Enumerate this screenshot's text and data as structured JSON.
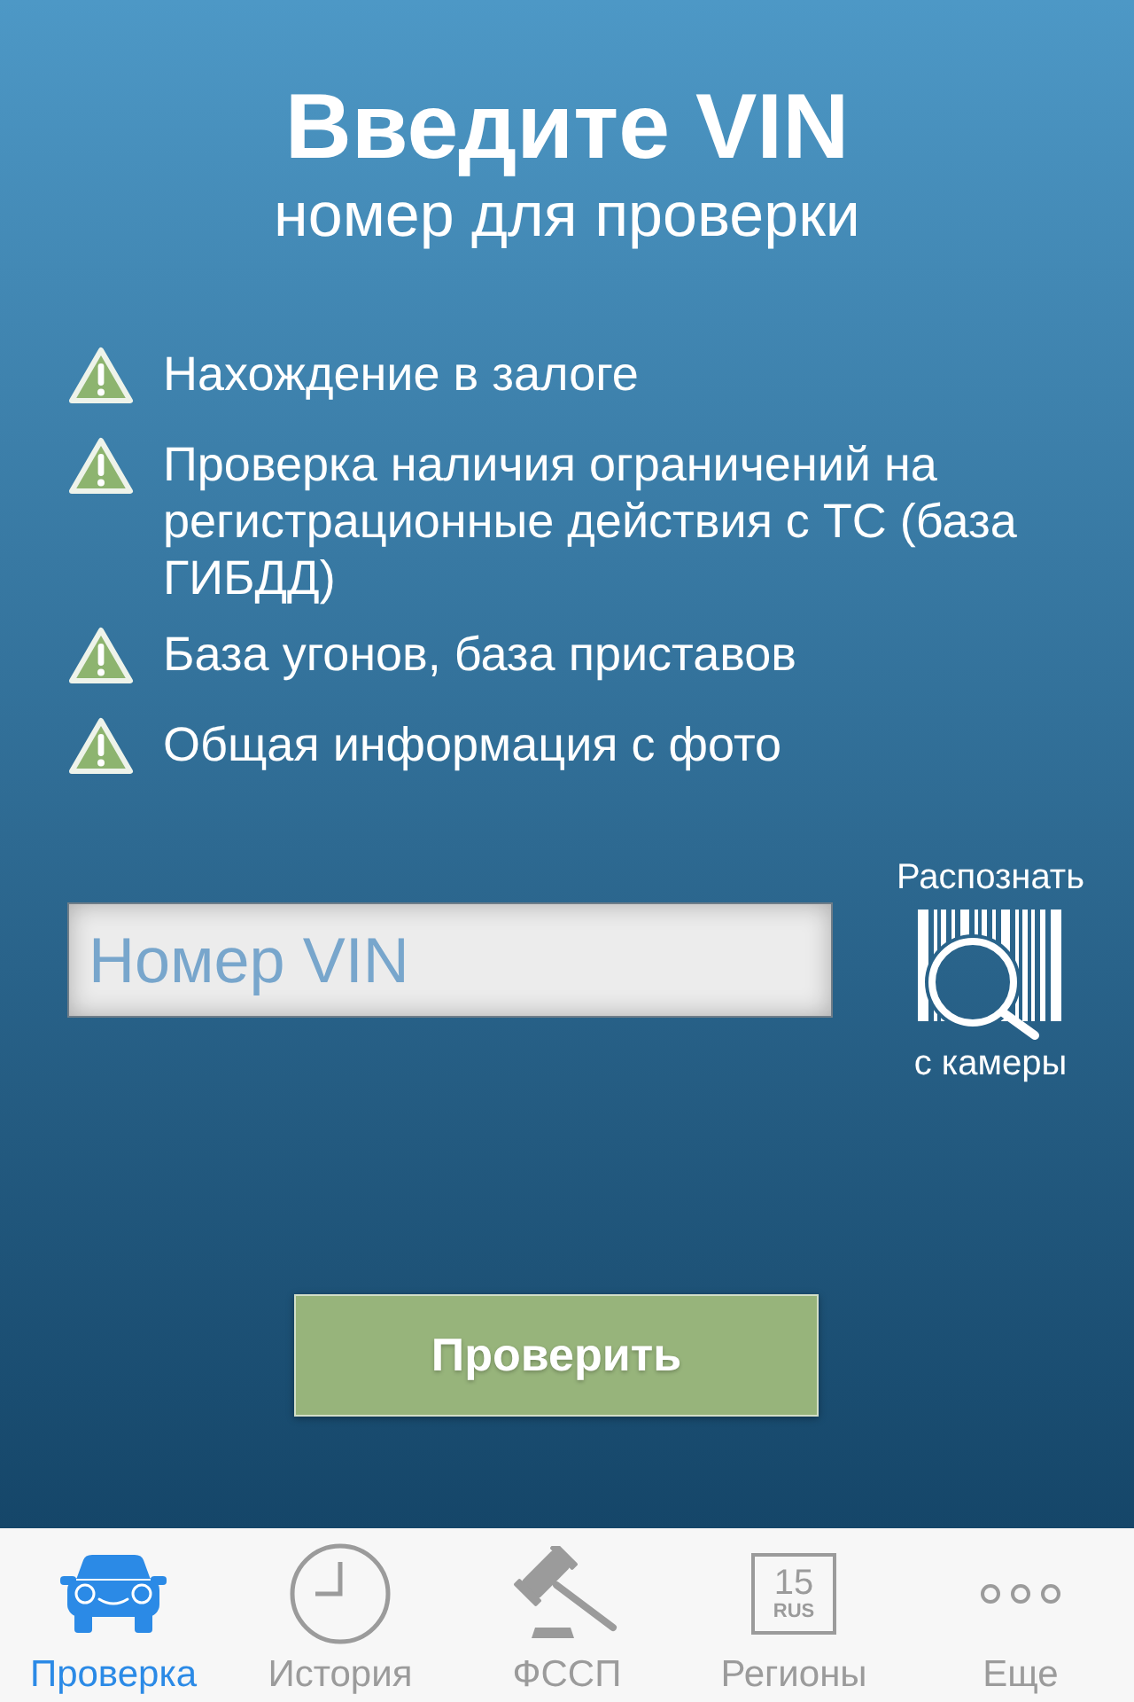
{
  "header": {
    "title": "Введите VIN",
    "subtitle": "номер для проверки"
  },
  "features": [
    "Нахождение в залоге",
    "Проверка наличия ограничений на регистрационные действия с ТС (база ГИБДД)",
    "База угонов, база приставов",
    "Общая информация с фото"
  ],
  "vin_input": {
    "placeholder": "Номер VIN"
  },
  "camera_scan": {
    "label_top": "Распознать",
    "label_bottom": "с камеры"
  },
  "submit_button": {
    "label": "Проверить"
  },
  "tab_bar": [
    {
      "label": "Проверка",
      "kind": "car",
      "selected": true
    },
    {
      "label": "История",
      "kind": "clock",
      "selected": false
    },
    {
      "label": "ФССП",
      "kind": "gavel",
      "selected": false
    },
    {
      "label": "Регионы",
      "kind": "plate",
      "selected": false,
      "plate_number": "15",
      "plate_region": "RUS"
    },
    {
      "label": "Еще",
      "kind": "more",
      "selected": false
    }
  ]
}
